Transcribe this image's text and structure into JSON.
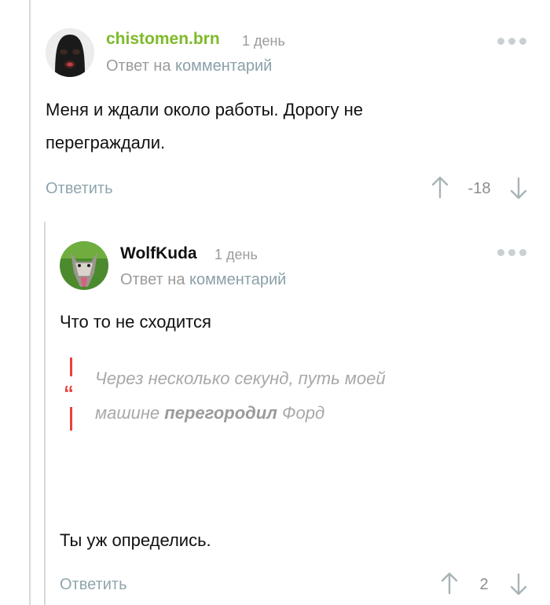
{
  "comment1": {
    "username": "chistomen.brn",
    "time": "1 день",
    "reply_prefix": "Ответ на",
    "reply_link": "комментарий",
    "text_line1": "Меня и ждали около работы. Дорогу не",
    "text_line2": "переграждали.",
    "reply_button": "Ответить",
    "rating": "-18",
    "username_color": "#7dba2a"
  },
  "comment2": {
    "username": "WolfKuda",
    "time": "1 день",
    "reply_prefix": "Ответ на",
    "reply_link": "комментарий",
    "text": "Что то не сходится",
    "quote": {
      "line1": "Через несколько секунд, путь моей",
      "line2_before": "машине",
      "line2_bold": "перегородил",
      "line2_after": "Форд"
    },
    "text2": "Ты уж определись.",
    "reply_button": "Ответить",
    "rating": "2"
  },
  "icons": [
    "more-options-icon",
    "upvote-icon",
    "downvote-icon",
    "quote-icon"
  ]
}
